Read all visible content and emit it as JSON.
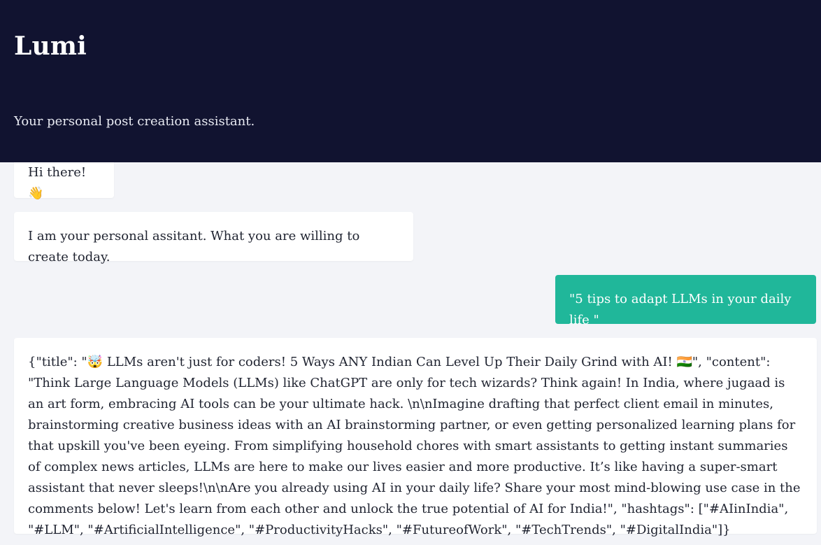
{
  "header": {
    "title": "Lumi",
    "subtitle": "Your personal post creation assistant."
  },
  "messages": [
    {
      "role": "assistant",
      "text": "Hi there! 👋"
    },
    {
      "role": "assistant",
      "text": "I am your personal assitant. What you are willing to create today."
    },
    {
      "role": "user",
      "text": "\"5 tips to adapt LLMs in your daily life \""
    },
    {
      "role": "assistant",
      "text": "{\"title\": \"🤯 LLMs aren't just for coders! 5 Ways ANY Indian Can Level Up Their Daily Grind with AI! 🇮🇳\", \"content\": \"Think Large Language Models (LLMs) like ChatGPT are only for tech wizards? Think again! In India, where jugaad is an art form, embracing AI tools can be your ultimate hack. \\n\\nImagine drafting that perfect client email in minutes, brainstorming creative business ideas with an AI brainstorming partner, or even getting personalized learning plans for that upskill you've been eyeing. From simplifying household chores with smart assistants to getting instant summaries of complex news articles, LLMs are here to make our lives easier and more productive. It’s like having a super-smart assistant that never sleeps!\\n\\nAre you already using AI in your daily life? Share your most mind-blowing use case in the comments below! Let's learn from each other and unlock the true potential of AI for India!\", \"hashtags\": [\"#AIinIndia\", \"#LLM\", \"#ArtificialIntelligence\", \"#ProductivityHacks\", \"#FutureofWork\", \"#TechTrends\", \"#DigitalIndia\"]}"
    }
  ],
  "colors": {
    "header_bg": "#111330",
    "page_bg": "#f3f4f8",
    "assistant_bubble": "#ffffff",
    "user_bubble": "#20b79a"
  }
}
